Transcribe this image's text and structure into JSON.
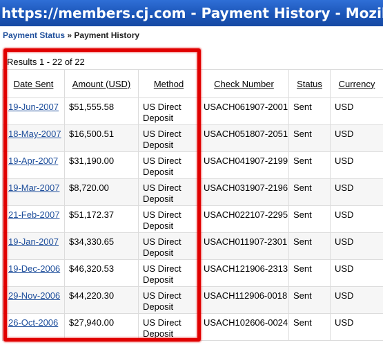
{
  "window": {
    "title": "https://members.cj.com - Payment History - Mozilla"
  },
  "breadcrumb": {
    "parent": "Payment Status",
    "separator": "»",
    "current": "Payment History"
  },
  "results_text": "Results 1 - 22 of 22",
  "table": {
    "headers": {
      "date": "Date Sent",
      "amount": "Amount (USD)",
      "method": "Method",
      "check": "Check Number",
      "status": "Status",
      "currency": "Currency"
    },
    "rows": [
      {
        "date": "19-Jun-2007",
        "amount": "$51,555.58",
        "method": "US Direct Deposit",
        "check": "USACH061907-2001",
        "status": "Sent",
        "currency": "USD"
      },
      {
        "date": "18-May-2007",
        "amount": "$16,500.51",
        "method": "US Direct Deposit",
        "check": "USACH051807-2051",
        "status": "Sent",
        "currency": "USD"
      },
      {
        "date": "19-Apr-2007",
        "amount": "$31,190.00",
        "method": "US Direct Deposit",
        "check": "USACH041907-2199",
        "status": "Sent",
        "currency": "USD"
      },
      {
        "date": "19-Mar-2007",
        "amount": "$8,720.00",
        "method": "US Direct Deposit",
        "check": "USACH031907-2196",
        "status": "Sent",
        "currency": "USD"
      },
      {
        "date": "21-Feb-2007",
        "amount": "$51,172.37",
        "method": "US Direct Deposit",
        "check": "USACH022107-2295",
        "status": "Sent",
        "currency": "USD"
      },
      {
        "date": "19-Jan-2007",
        "amount": "$34,330.65",
        "method": "US Direct Deposit",
        "check": "USACH011907-2301",
        "status": "Sent",
        "currency": "USD"
      },
      {
        "date": "19-Dec-2006",
        "amount": "$46,320.53",
        "method": "US Direct Deposit",
        "check": "USACH121906-2313",
        "status": "Sent",
        "currency": "USD"
      },
      {
        "date": "29-Nov-2006",
        "amount": "$44,220.30",
        "method": "US Direct Deposit",
        "check": "USACH112906-0018",
        "status": "Sent",
        "currency": "USD"
      },
      {
        "date": "26-Oct-2006",
        "amount": "$27,940.00",
        "method": "US Direct Deposit",
        "check": "USACH102606-0024",
        "status": "Sent",
        "currency": "USD"
      }
    ]
  },
  "colors": {
    "titlebar": "#1b55b8",
    "link": "#1f4f9c",
    "annotation": "#e00000"
  }
}
